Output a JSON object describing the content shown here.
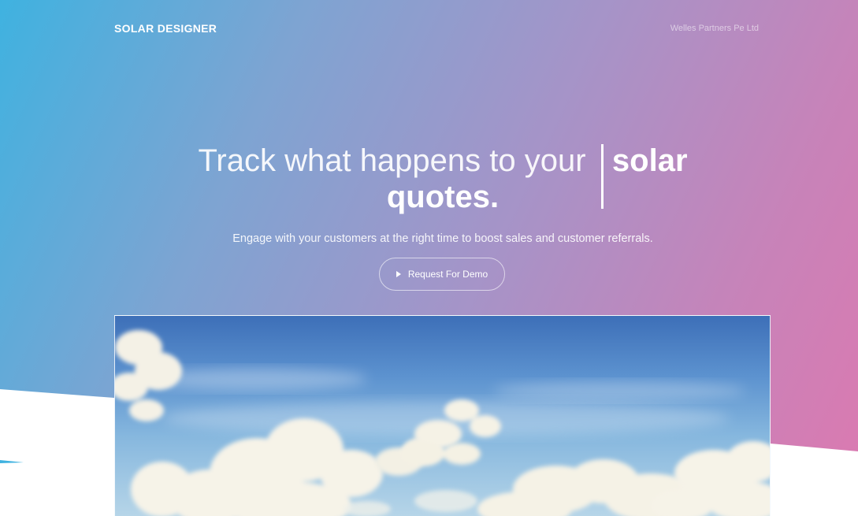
{
  "header": {
    "brand": "SOLAR DESIGNER",
    "company": "Welles Partners Pe Ltd"
  },
  "hero": {
    "headline_light": "Track what happens to your",
    "headline_bold_1": "solar",
    "headline_bold_2": "quotes.",
    "subline": "Engage with your customers at the right time to boost sales and customer referrals.",
    "cta_label": "Request For Demo"
  },
  "icons": {
    "cta_icon": "play-icon"
  },
  "colors": {
    "gradient_start": "#3fb2e0",
    "gradient_mid": "#a594c8",
    "gradient_end": "#dc79b0"
  }
}
